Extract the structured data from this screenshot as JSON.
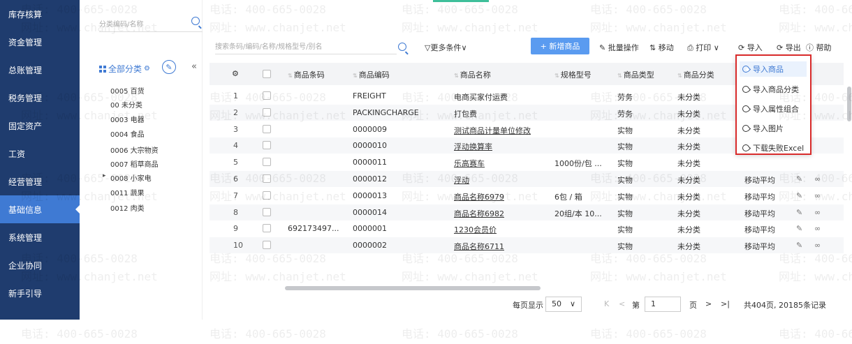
{
  "nav": {
    "items": [
      "库存核算",
      "资金管理",
      "总账管理",
      "税务管理",
      "固定资产",
      "工资",
      "经营管理",
      "基础信息",
      "系统管理",
      "企业协同",
      "新手引导"
    ],
    "active_index": 7
  },
  "category": {
    "search_placeholder": "分类编码/名称",
    "all_label": "全部分类",
    "items": [
      "0005 百货",
      "00 未分类",
      "0003 电器",
      "0004 食品",
      "0006 大宗物资",
      "0007 稻草商品",
      "0008 小家电",
      "0011 蔬果",
      "0012 肉类"
    ]
  },
  "toolbar": {
    "search_placeholder": "搜索条码/编码/名称/规格型号/别名",
    "more_filters": "▽更多条件∨",
    "new_button": "+ 新增商品",
    "batch": "批量操作",
    "move": "⇅ 移动",
    "print": "打印 ∨",
    "import": "导入",
    "export": "导出",
    "help": "帮助"
  },
  "table": {
    "headers": [
      "商品条码",
      "商品编码",
      "商品名称",
      "规格型号",
      "商品类型",
      "商品分类"
    ],
    "rows": [
      {
        "no": "1",
        "barcode": "",
        "code": "FREIGHT",
        "name": "电商买家付运费",
        "spec": "",
        "type": "劳务",
        "category": "未分类",
        "cost": "",
        "name_link": false
      },
      {
        "no": "2",
        "barcode": "",
        "code": "PACKINGCHARGE",
        "name": "打包费",
        "spec": "",
        "type": "劳务",
        "category": "未分类",
        "cost": "",
        "name_link": false
      },
      {
        "no": "3",
        "barcode": "",
        "code": "0000009",
        "name": "测试商品计量单位修改",
        "spec": "",
        "type": "实物",
        "category": "未分类",
        "cost": "",
        "name_link": true
      },
      {
        "no": "4",
        "barcode": "",
        "code": "0000010",
        "name": "浮动换算率",
        "spec": "",
        "type": "实物",
        "category": "未分类",
        "cost": "",
        "name_link": true
      },
      {
        "no": "5",
        "barcode": "",
        "code": "0000011",
        "name": "乐高赛车",
        "spec": "1000份/包 ...",
        "type": "实物",
        "category": "未分类",
        "cost": "",
        "name_link": true
      },
      {
        "no": "6",
        "barcode": "",
        "code": "0000012",
        "name": "浮动",
        "spec": "",
        "type": "实物",
        "category": "未分类",
        "cost": "移动平均",
        "name_link": true
      },
      {
        "no": "7",
        "barcode": "",
        "code": "0000013",
        "name": "商品名称6979",
        "spec": "6包 / 箱",
        "type": "实物",
        "category": "未分类",
        "cost": "移动平均",
        "name_link": true
      },
      {
        "no": "8",
        "barcode": "",
        "code": "0000014",
        "name": "商品名称6982",
        "spec": "20组/本 10...",
        "type": "实物",
        "category": "未分类",
        "cost": "移动平均",
        "name_link": true
      },
      {
        "no": "9",
        "barcode": "692173497...",
        "code": "0000001",
        "name": "1230会员价",
        "spec": "",
        "type": "实物",
        "category": "未分类",
        "cost": "移动平均",
        "name_link": true
      },
      {
        "no": "10",
        "barcode": "",
        "code": "0000002",
        "name": "商品名称6711",
        "spec": "",
        "type": "实物",
        "category": "未分类",
        "cost": "移动平均",
        "name_link": true
      }
    ]
  },
  "pagination": {
    "per_page_label": "每页显示",
    "per_page_value": "50",
    "page_prefix": "第",
    "page_value": "1",
    "page_suffix": "页",
    "summary": "共404页, 20185条记录"
  },
  "import_menu": {
    "items": [
      "导入商品",
      "导入商品分类",
      "导入属性组合",
      "导入图片",
      "下载失败Excel"
    ]
  },
  "watermark": {
    "phone": "电话: 400-665-0028",
    "site": "网址: www.chanjet.net"
  }
}
